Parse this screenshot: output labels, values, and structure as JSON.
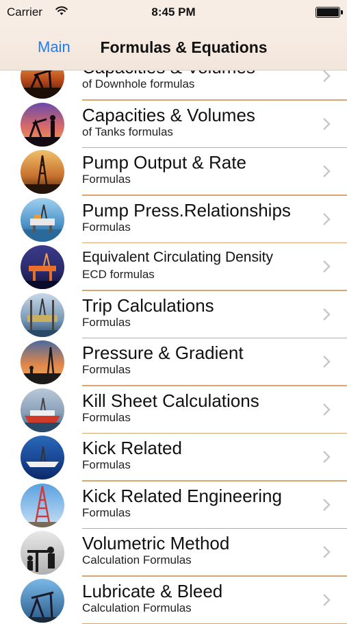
{
  "status": {
    "carrier": "Carrier",
    "time": "8:45 PM"
  },
  "nav": {
    "back_label": "Main",
    "title": "Formulas & Equations"
  },
  "rows": [
    {
      "title": "Capacities & Volumes",
      "subtitle": "of Downhole formulas",
      "icon": "pumpjack-sunset-photo"
    },
    {
      "title": "Capacities & Volumes",
      "subtitle": "of Tanks formulas",
      "icon": "pumpjack-worker-photo"
    },
    {
      "title": "Pump Output & Rate",
      "subtitle": "Formulas",
      "icon": "drilling-rig-dusk-photo"
    },
    {
      "title": "Pump Press.Relationships",
      "subtitle": "Formulas",
      "icon": "offshore-platform-photo"
    },
    {
      "title": "Equivalent Circulating Density",
      "subtitle": "ECD formulas",
      "icon": "platform-night-photo"
    },
    {
      "title": "Trip Calculations",
      "subtitle": "Formulas",
      "icon": "jackup-rig-photo"
    },
    {
      "title": "Pressure & Gradient",
      "subtitle": "Formulas",
      "icon": "rig-silhouette-photo"
    },
    {
      "title": "Kill Sheet Calculations",
      "subtitle": "Formulas",
      "icon": "drillship-photo"
    },
    {
      "title": "Kick Related",
      "subtitle": "Formulas",
      "icon": "drillship-sea-photo"
    },
    {
      "title": "Kick Related Engineering",
      "subtitle": "Formulas",
      "icon": "derrick-blue-sky-photo"
    },
    {
      "title": "Volumetric Method",
      "subtitle": "Calculation Formulas",
      "icon": "workers-silhouette-photo"
    },
    {
      "title": "Lubricate & Bleed",
      "subtitle": "Calculation Formulas",
      "icon": "pumpjack-blue-photo"
    }
  ]
}
